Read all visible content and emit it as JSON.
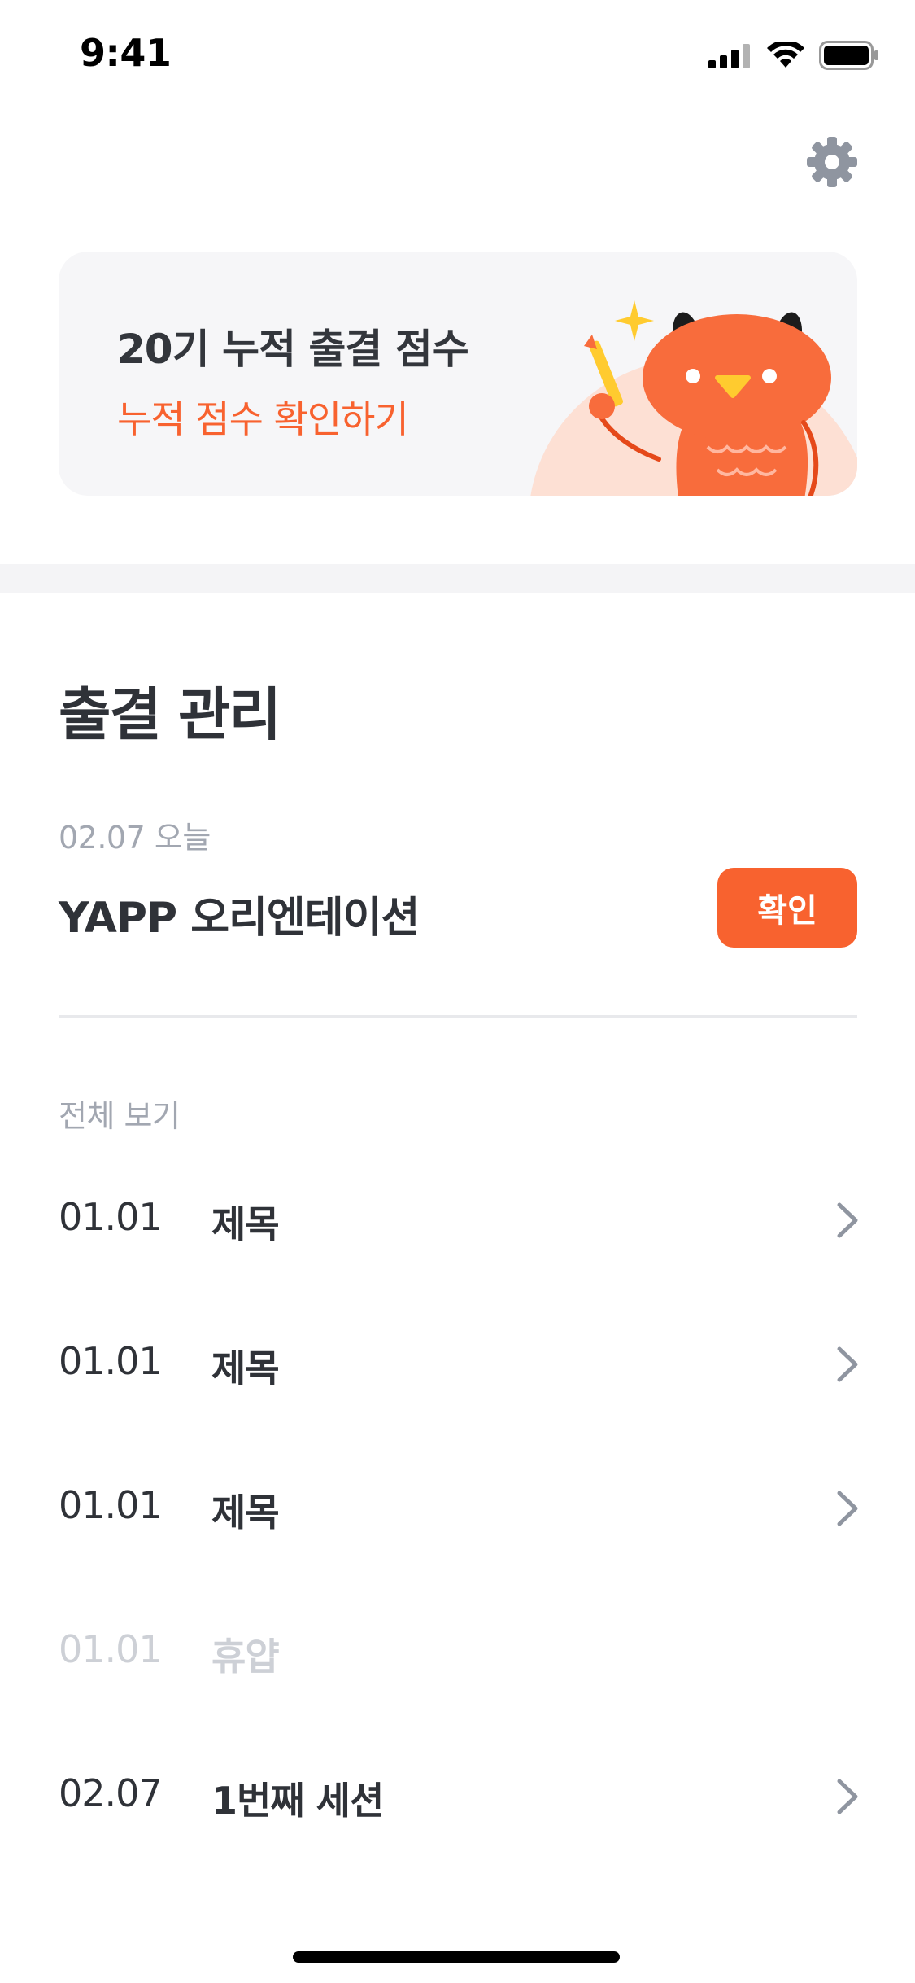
{
  "status_bar": {
    "time": "9:41"
  },
  "score_card": {
    "title": "20기 누적 출결 점수",
    "link": "누적 점수 확인하기"
  },
  "attendance": {
    "section_title": "출결 관리",
    "today": {
      "label": "02.07 오늘",
      "title": "YAPP 오리엔테이션",
      "confirm_label": "확인"
    },
    "all_label": "전체 보기",
    "items": [
      {
        "date": "01.01",
        "title": "제목",
        "disabled": false
      },
      {
        "date": "01.01",
        "title": "제목",
        "disabled": false
      },
      {
        "date": "01.01",
        "title": "제목",
        "disabled": false
      },
      {
        "date": "01.01",
        "title": "휴얍",
        "disabled": true
      },
      {
        "date": "02.07",
        "title": "1번째 세션",
        "disabled": false
      }
    ]
  },
  "icons": {
    "settings": "gear-icon",
    "chevron": "chevron-right-icon",
    "signal": "cellular-signal-icon",
    "wifi": "wifi-icon",
    "battery": "battery-icon",
    "mascot": "mascot-illustration"
  },
  "colors": {
    "accent": "#f8622f",
    "text_primary": "#2f3238",
    "text_secondary": "#a2a7b1",
    "text_disabled": "#cdd0d6",
    "card_bg": "#f6f6f8"
  }
}
